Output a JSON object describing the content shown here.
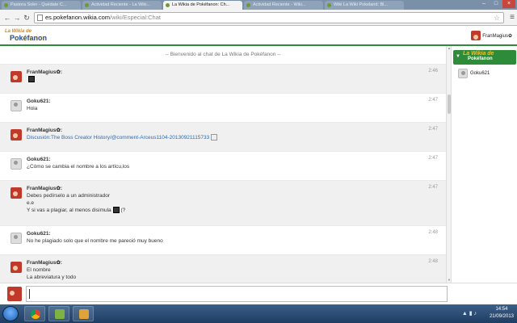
{
  "browser": {
    "tabs": [
      {
        "label": "Pastora Soler - Quédate C...",
        "active": false
      },
      {
        "label": "Actividad Reciente - La Wiki...",
        "active": false
      },
      {
        "label": "La Wikia de Pokéfanon: Ch...",
        "active": true
      },
      {
        "label": "Actividad Reciente - Wiki...",
        "active": false
      },
      {
        "label": "Wiki La Wiki Pokeland: Bl...",
        "active": false
      }
    ],
    "url_host": "es.pokefanon.wikia.com",
    "url_path": "/wiki/Especial:Chat"
  },
  "header": {
    "logo_line1": "La Wikia de",
    "logo_line2": "Pokéfanon",
    "current_user": "FranMagius✿"
  },
  "chat": {
    "welcome": "-- Bienvenido al chat de La Wikia de Pokéfanon --",
    "messages": [
      {
        "author": "FranMagius✿:",
        "time": "2:46",
        "lines": [
          ""
        ],
        "emote": true,
        "alt": true
      },
      {
        "author": "Goku621:",
        "time": "2:47",
        "lines": [
          "Hola"
        ],
        "alt": false
      },
      {
        "author": "FranMagius✿:",
        "time": "2:47",
        "lines": [
          "Discusión:The Boss Creator History/@comment-Arceus1104-20130921115733"
        ],
        "alt": true
      },
      {
        "author": "Goku621:",
        "time": "2:47",
        "lines": [
          "¿Cómo se cambia el nombre a los artícu,los"
        ],
        "alt": false
      },
      {
        "author": "FranMagius✿:",
        "time": "2:47",
        "lines": [
          "Debes pedírselo a un administrador",
          "e.e",
          "Y si vas a plagiar, al menos disimula",
          "(?"
        ],
        "alt": true
      },
      {
        "author": "Goku621:",
        "time": "2:48",
        "lines": [
          "No he plagiado solo que el nombre me pareció muy bueno"
        ],
        "alt": false
      },
      {
        "author": "FranMagius✿:",
        "time": "2:48",
        "lines": [
          "El nombre",
          "La abreviatura y todo"
        ],
        "alt": true
      }
    ]
  },
  "userlist": {
    "header_line1": "La Wikia de",
    "header_line2": "Pokéfanon",
    "users": [
      "Goku621"
    ]
  },
  "taskbar": {
    "time": "14:54",
    "date": "21/09/2013"
  }
}
